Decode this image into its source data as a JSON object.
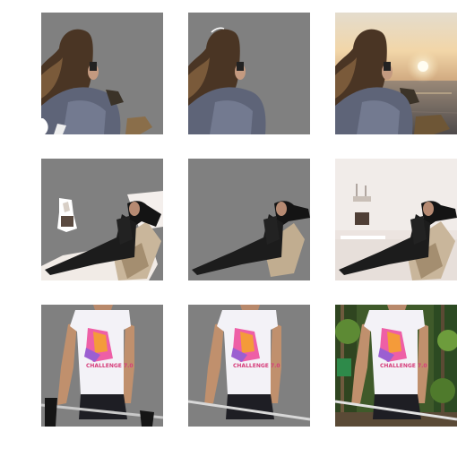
{
  "figure": {
    "rows": [
      {
        "subject": "woman photographing sunset by the sea",
        "panels": [
          "mask-prediction",
          "mask-ground-truth",
          "original-photo"
        ]
      },
      {
        "subject": "woman in black reclining on sofa",
        "panels": [
          "mask-prediction",
          "mask-ground-truth",
          "original-photo"
        ]
      },
      {
        "subject": "man in white printed t-shirt holding barbell",
        "panels": [
          "mask-prediction",
          "mask-ground-truth",
          "original-photo"
        ]
      }
    ],
    "colors": {
      "mask_background": "#808080",
      "page_background": "#ffffff"
    },
    "tshirt_print_text": "CHALLENGE 7.0"
  }
}
